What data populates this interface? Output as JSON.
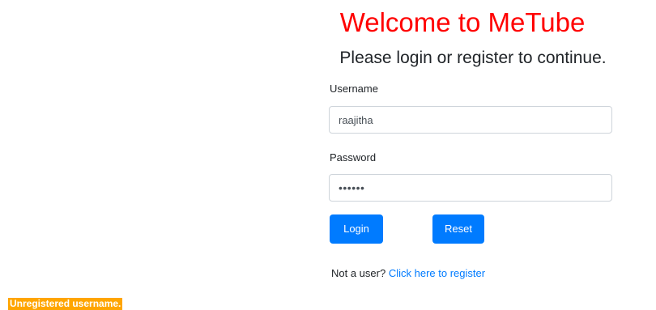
{
  "header": {
    "title": "Welcome to MeTube",
    "subtitle": "Please login or register to continue."
  },
  "form": {
    "username_label": "Username",
    "username_value": "raajitha",
    "password_label": "Password",
    "password_value": "••••••",
    "login_label": "Login",
    "reset_label": "Reset"
  },
  "register": {
    "prompt": "Not a user?",
    "link_text": "Click here to register"
  },
  "status": {
    "error": "Unregistered username."
  },
  "colors": {
    "title": "#ff0000",
    "button": "#007bff",
    "link": "#007bff",
    "error_bg": "#ffa500"
  }
}
